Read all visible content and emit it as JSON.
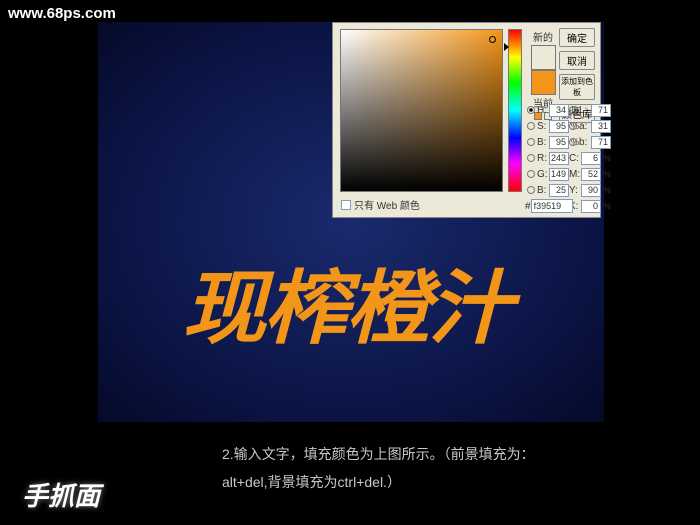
{
  "watermark": "www.68ps.com",
  "canvas": {
    "headline": "现榨橙汁"
  },
  "dlg": {
    "new_label": "新的",
    "cur_label": "当前",
    "swatch_new": "#f39518",
    "swatch_cur": "#f39518",
    "btn_ok": "确定",
    "btn_cancel": "取消",
    "btn_add": "添加到色板",
    "btn_lib": "颜色库",
    "H": {
      "l": "H:",
      "v": "34",
      "u": "度"
    },
    "S": {
      "l": "S:",
      "v": "95",
      "u": "%"
    },
    "Bv": {
      "l": "B:",
      "v": "95",
      "u": "%"
    },
    "R": {
      "l": "R:",
      "v": "243"
    },
    "G": {
      "l": "G:",
      "v": "149"
    },
    "Bl": {
      "l": "B:",
      "v": "25"
    },
    "L": {
      "l": "L:",
      "v": "71"
    },
    "a": {
      "l": "a:",
      "v": "31"
    },
    "b": {
      "l": "b:",
      "v": "71"
    },
    "C": {
      "l": "C:",
      "v": "6",
      "u": "%"
    },
    "M": {
      "l": "M:",
      "v": "52",
      "u": "%"
    },
    "Y": {
      "l": "Y:",
      "v": "90",
      "u": "%"
    },
    "K": {
      "l": "K:",
      "v": "0",
      "u": "%"
    },
    "webonly": "只有 Web 颜色",
    "hex_l": "#",
    "hex_v": "f39519"
  },
  "caption": {
    "line1": "2.输入文字，填充颜色为上图所示。（前景填充为：",
    "line2": "alt+del,背景填充为ctrl+del.）"
  },
  "logo": "手抓面"
}
